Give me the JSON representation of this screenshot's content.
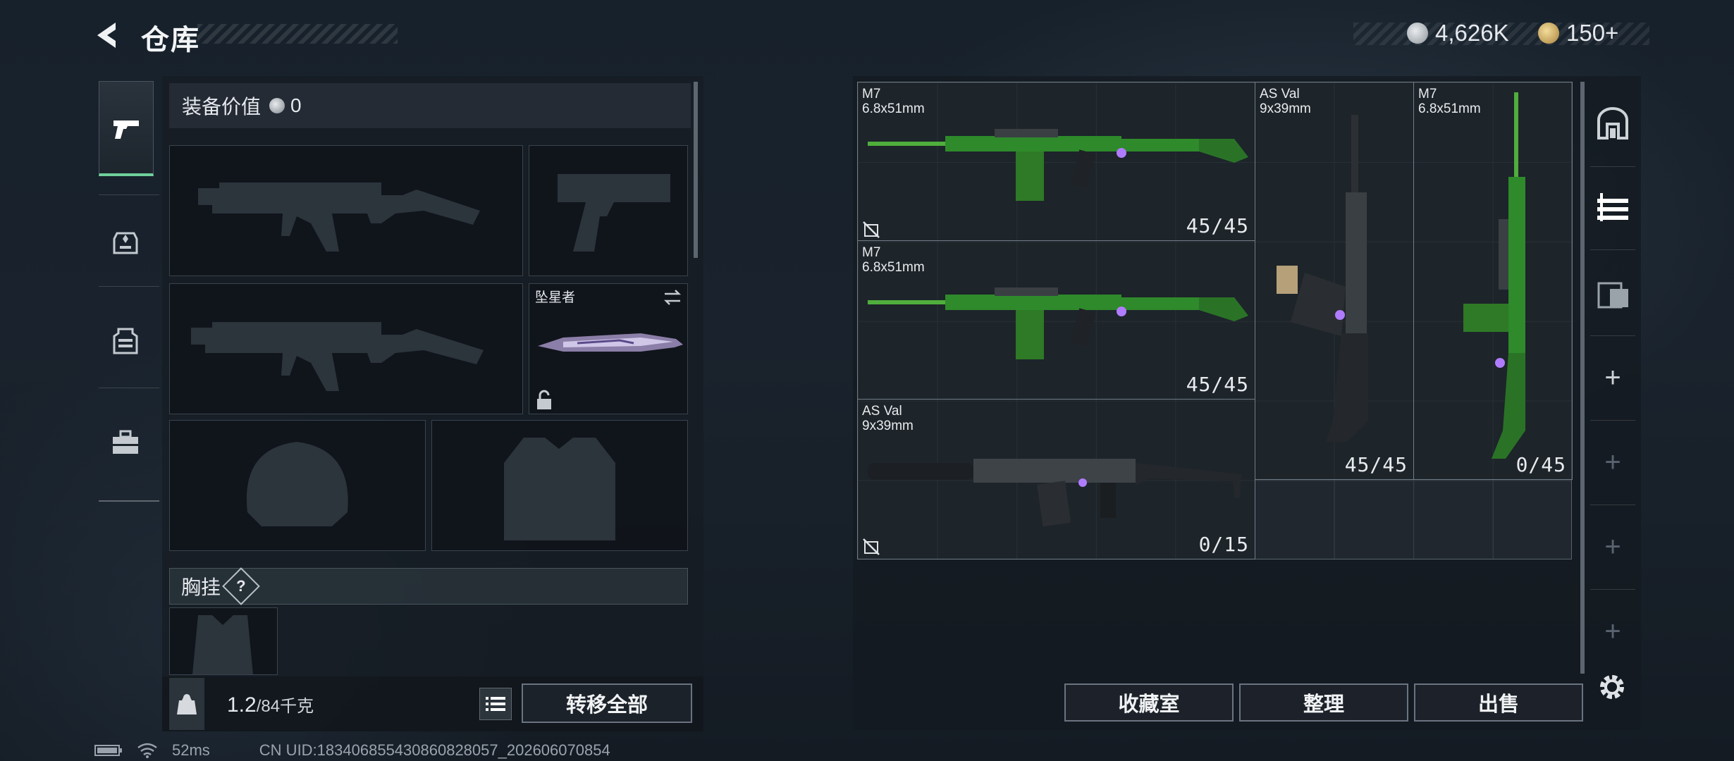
{
  "header": {
    "title": "仓库",
    "currency_silver": "4,626K",
    "currency_gold": "150+"
  },
  "loadout": {
    "value_label": "装备价值",
    "value_amount": "0",
    "melee_name": "坠星者",
    "chest_rig_label": "胸挂",
    "chest_rig_help": "?",
    "weight_current": "1.2",
    "weight_max": "/84千克",
    "transfer_all_label": "转移全部"
  },
  "stash": {
    "items": [
      {
        "name": "M7",
        "caliber": "6.8x51mm",
        "ammo": "45/45",
        "color": "green"
      },
      {
        "name": "M7",
        "caliber": "6.8x51mm",
        "ammo": "45/45",
        "color": "green"
      },
      {
        "name": "AS Val",
        "caliber": "9x39mm",
        "ammo": "0/15",
        "color": "dark"
      },
      {
        "name": "AS Val",
        "caliber": "9x39mm",
        "ammo": "45/45",
        "color": "dark"
      },
      {
        "name": "M7",
        "caliber": "6.8x51mm",
        "ammo": "0/45",
        "color": "green"
      }
    ],
    "buttons": {
      "collection": "收藏室",
      "sort": "整理",
      "sell": "出售"
    }
  },
  "right_tabs": {
    "add_symbol": "+"
  },
  "footer": {
    "ping": "52ms",
    "uid": "CN UID:183406855430860828057_202606070854"
  },
  "colors": {
    "accent_green": "#6fd09c",
    "weapon_green": "#2e8a2a",
    "silver_coin": "#c9cdd2",
    "gold_coin": "#d8b56a"
  },
  "icons": [
    "back-arrow-icon",
    "pistol-icon",
    "helmet-backpack-icon",
    "vest-icon",
    "toolbox-icon",
    "silver-coin-icon",
    "gold-coin-icon",
    "lock-icon",
    "weight-icon",
    "list-icon",
    "swap-icon",
    "no-insurance-icon",
    "arch-icon",
    "shelf-icon",
    "cabinet-icon",
    "plus-icon",
    "gear-icon",
    "battery-icon",
    "wifi-icon"
  ]
}
